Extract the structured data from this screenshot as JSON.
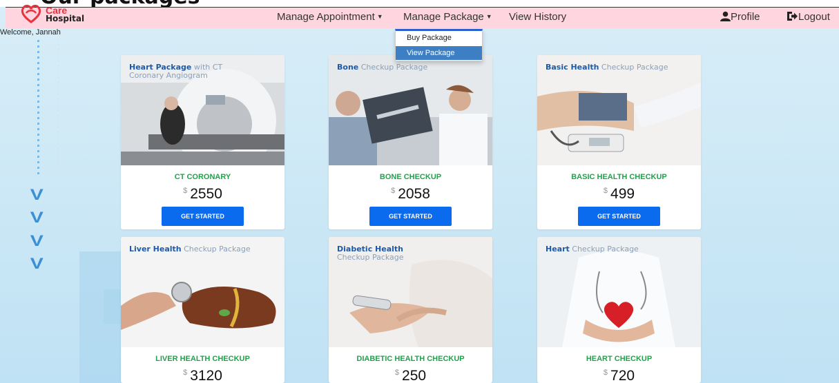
{
  "page": {
    "heading": "Our packages"
  },
  "brand": {
    "care": "Care",
    "hospital": "Hospital"
  },
  "nav": {
    "manage_appointment": "Manage Appointment",
    "manage_package": "Manage Package",
    "view_history": "View History",
    "profile": "Profile",
    "logout": "Logout"
  },
  "dropdown": {
    "items": [
      {
        "label": "Buy Package"
      },
      {
        "label": "View Package"
      }
    ]
  },
  "welcome": "Welcome, Jannah",
  "packages": [
    {
      "title_bold": "Heart Package",
      "title_rest": " with CT",
      "title_line2": "Coronary Angiogram",
      "name": "CT CORONARY",
      "currency": "$",
      "price": "2550",
      "button": "GET STARTED"
    },
    {
      "title_bold": "Bone",
      "title_rest": " Checkup Package",
      "title_line2": "",
      "name": "BONE CHECKUP",
      "currency": "$",
      "price": "2058",
      "button": "GET STARTED"
    },
    {
      "title_bold": "Basic Health",
      "title_rest": " Checkup Package",
      "title_line2": "",
      "name": "BASIC HEALTH CHECKUP",
      "currency": "$",
      "price": "499",
      "button": "GET STARTED"
    },
    {
      "title_bold": "Liver Health",
      "title_rest": " Checkup Package",
      "title_line2": "",
      "name": "LIVER HEALTH CHECKUP",
      "currency": "$",
      "price": "3120"
    },
    {
      "title_bold": "Diabetic Health",
      "title_rest": "",
      "title_line2": "Checkup Package",
      "name": "DIABETIC HEALTH CHECKUP",
      "currency": "$",
      "price": "250"
    },
    {
      "title_bold": "Heart",
      "title_rest": " Checkup Package",
      "title_line2": "",
      "name": "HEART CHECKUP",
      "currency": "$",
      "price": "720"
    }
  ],
  "colors": {
    "navbar": "#ffd6df",
    "button": "#0b6bef",
    "package_name": "#1fa34a",
    "dropdown_active": "#3d7fc4"
  }
}
